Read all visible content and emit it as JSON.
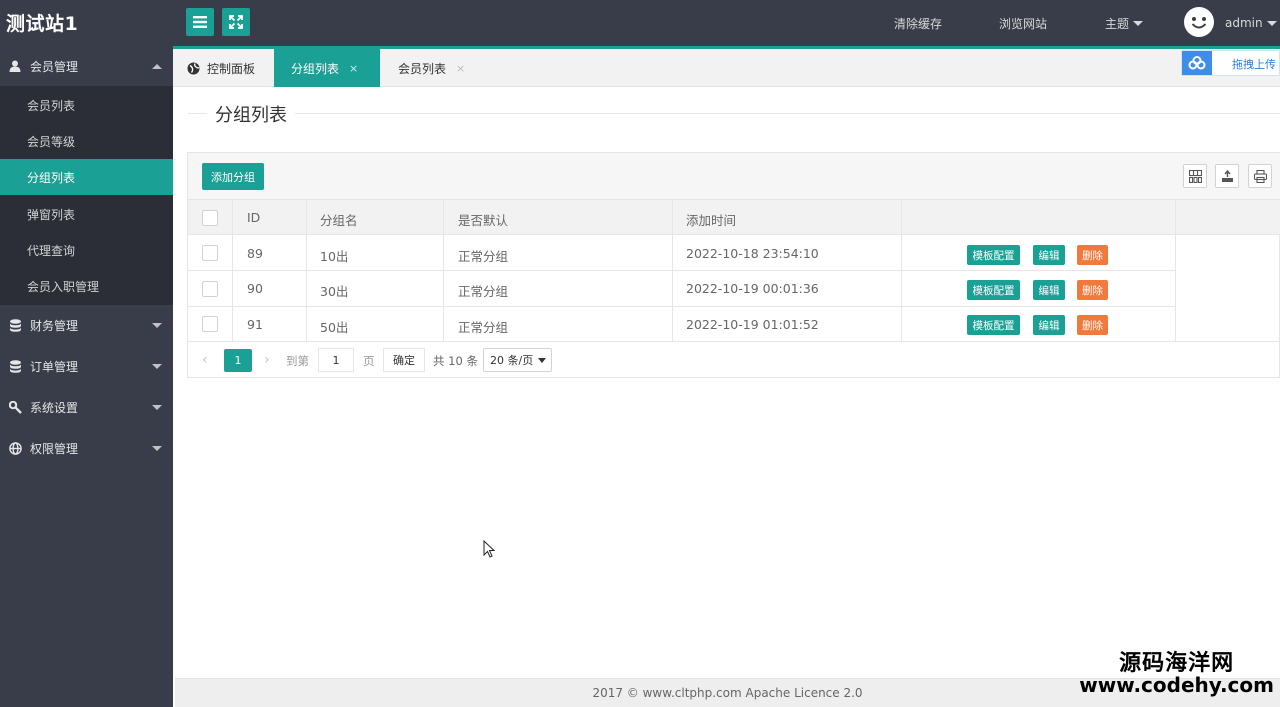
{
  "app": {
    "title": "测试站1",
    "user": "admin"
  },
  "topbar": {
    "links": [
      "清除缓存",
      "浏览网站",
      "主题"
    ]
  },
  "sidebar": {
    "groups": [
      {
        "label": "会员管理",
        "icon": "user-icon",
        "expanded": true
      },
      {
        "label": "财务管理",
        "icon": "database-icon"
      },
      {
        "label": "订单管理",
        "icon": "database-icon"
      },
      {
        "label": "系统设置",
        "icon": "wrench-icon"
      },
      {
        "label": "权限管理",
        "icon": "globe-icon"
      }
    ],
    "items": [
      "会员列表",
      "会员等级",
      "分组列表",
      "弹窗列表",
      "代理查询",
      "会员入职管理"
    ],
    "active_item": "分组列表"
  },
  "tabs": [
    {
      "label": "控制面板",
      "icon": "globe-icon"
    },
    {
      "label": "分组列表",
      "close": "×",
      "active": true
    },
    {
      "label": "会员列表",
      "close": "×"
    }
  ],
  "upload": {
    "label": "拖拽上传"
  },
  "page": {
    "title": "分组列表",
    "add_button": "添加分组"
  },
  "table": {
    "headers": [
      "ID",
      "分组名",
      "是否默认",
      "添加时间"
    ],
    "rows": [
      {
        "id": "89",
        "name": "10出",
        "default": "正常分组",
        "time": "2022-10-18 23:54:10"
      },
      {
        "id": "90",
        "name": "30出",
        "default": "正常分组",
        "time": "2022-10-19 00:01:36"
      },
      {
        "id": "91",
        "name": "50出",
        "default": "正常分组",
        "time": "2022-10-19 01:01:52"
      }
    ],
    "actions": [
      "模板配置",
      "编辑",
      "删除"
    ]
  },
  "pager": {
    "current": "1",
    "goto_label": "到第",
    "input_value": "1",
    "page_label": "页",
    "ok_label": "确定",
    "total": "共 10 条",
    "page_size": "20 条/页"
  },
  "footer": {
    "text": "2017 ©  www.cltphp.com  Apache Licence 2.0"
  },
  "watermark": {
    "line1": "源码海洋网",
    "line2": "www.codehy.com"
  },
  "colors": {
    "topbar": "#393d49",
    "submenu": "#2b2e37",
    "accent": "#1aa094",
    "danger": "#f0793b",
    "upload_blue": "#3c8ee6"
  }
}
